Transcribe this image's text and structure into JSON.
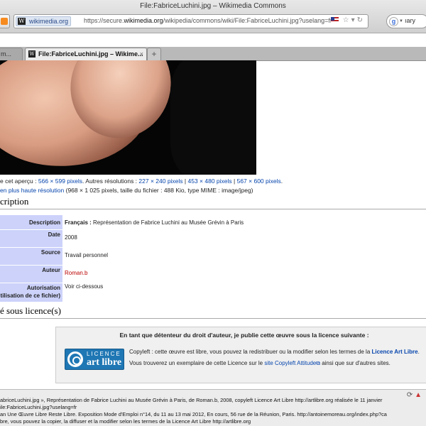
{
  "window": {
    "title": "File:FabriceLuchini.jpg – Wikimedia Commons"
  },
  "urlbar": {
    "site_identity": "wikimedia.org",
    "url_prefix": "https://secure.",
    "url_domain": "wikimedia.org",
    "url_path": "/wikipedia/commons/wiki/File:FabriceLuchini.jpg?uselang=fr"
  },
  "search": {
    "text": "ıary"
  },
  "tabs": [
    {
      "label": "m..."
    },
    {
      "label": "File:FabriceLuchini.jpg – Wikime..."
    }
  ],
  "preview": {
    "res_prefix": "e cet aperçu : ",
    "res_current": "566 × 599 pixels",
    "res_mid": ". Autres résolutions : ",
    "res_options": [
      "227 × 240 pixels",
      "453 × 480 pixels",
      "567 × 600 pixels"
    ],
    "res_suffix": ".",
    "full_link": "en plus haute résolution",
    "full_info": " (968 × 1 025 pixels, taille du fichier : 488 Kio, type MIME : image/jpeg)"
  },
  "sections": {
    "description_heading": "cription",
    "license_heading": "é sous licence(s)"
  },
  "info": {
    "description_label": "Description",
    "description_lang": "Français :",
    "description_value": " Représentation de Fabrice Luchini au Musée Grévin à Paris",
    "date_label": "Date",
    "date_value": "2008",
    "source_label": "Source",
    "source_value": "Travail personnel",
    "author_label": "Auteur",
    "author_value": "Roman.b",
    "permission_label_1": "Autorisation",
    "permission_label_2": "tilisation de ce fichier)",
    "permission_value": "Voir ci-dessous"
  },
  "license": {
    "intro": "En tant que détenteur du droit d'auteur, je publie cette œuvre sous la licence suivante :",
    "logo_line1": "LICENCE",
    "logo_line2": "art libre",
    "text1_pre": "Copyleft : cette œuvre est libre, vous pouvez la redistribuer ou la modifier selon les termes de la ",
    "text1_link": "Licence Art Libre",
    "text1_post": ".",
    "text2_pre": "Vous trouverez un exemplaire de cette Licence sur le ",
    "text2_link": "site Copyleft Attitude",
    "text2_post": " ainsi que sur d'autres sites."
  },
  "status": {
    "line1": "abriceLuchini.jpg », Représentation de Fabrice Luchini au Musée Grévin à Paris, de Roman.b, 2008, copyleft Licence Art Libre http://artlibre.org réalisée le 11 janvier",
    "line2": "ile:FabriceLuchini.jpg?uselang=fr",
    "line3": "an Une Œuvre Libre Reste Libre. Exposition Mode d'Emploi n°14, du 11 au 13 mai 2012, En cours, 56 rue de la Réunion, Paris. http://antoinemoreau.org/index.php?ca",
    "line4": "bre, vous pouvez la copier, la diffuser et la modifier selon les termes de la Licence Art Libre http://artlibre.org"
  }
}
